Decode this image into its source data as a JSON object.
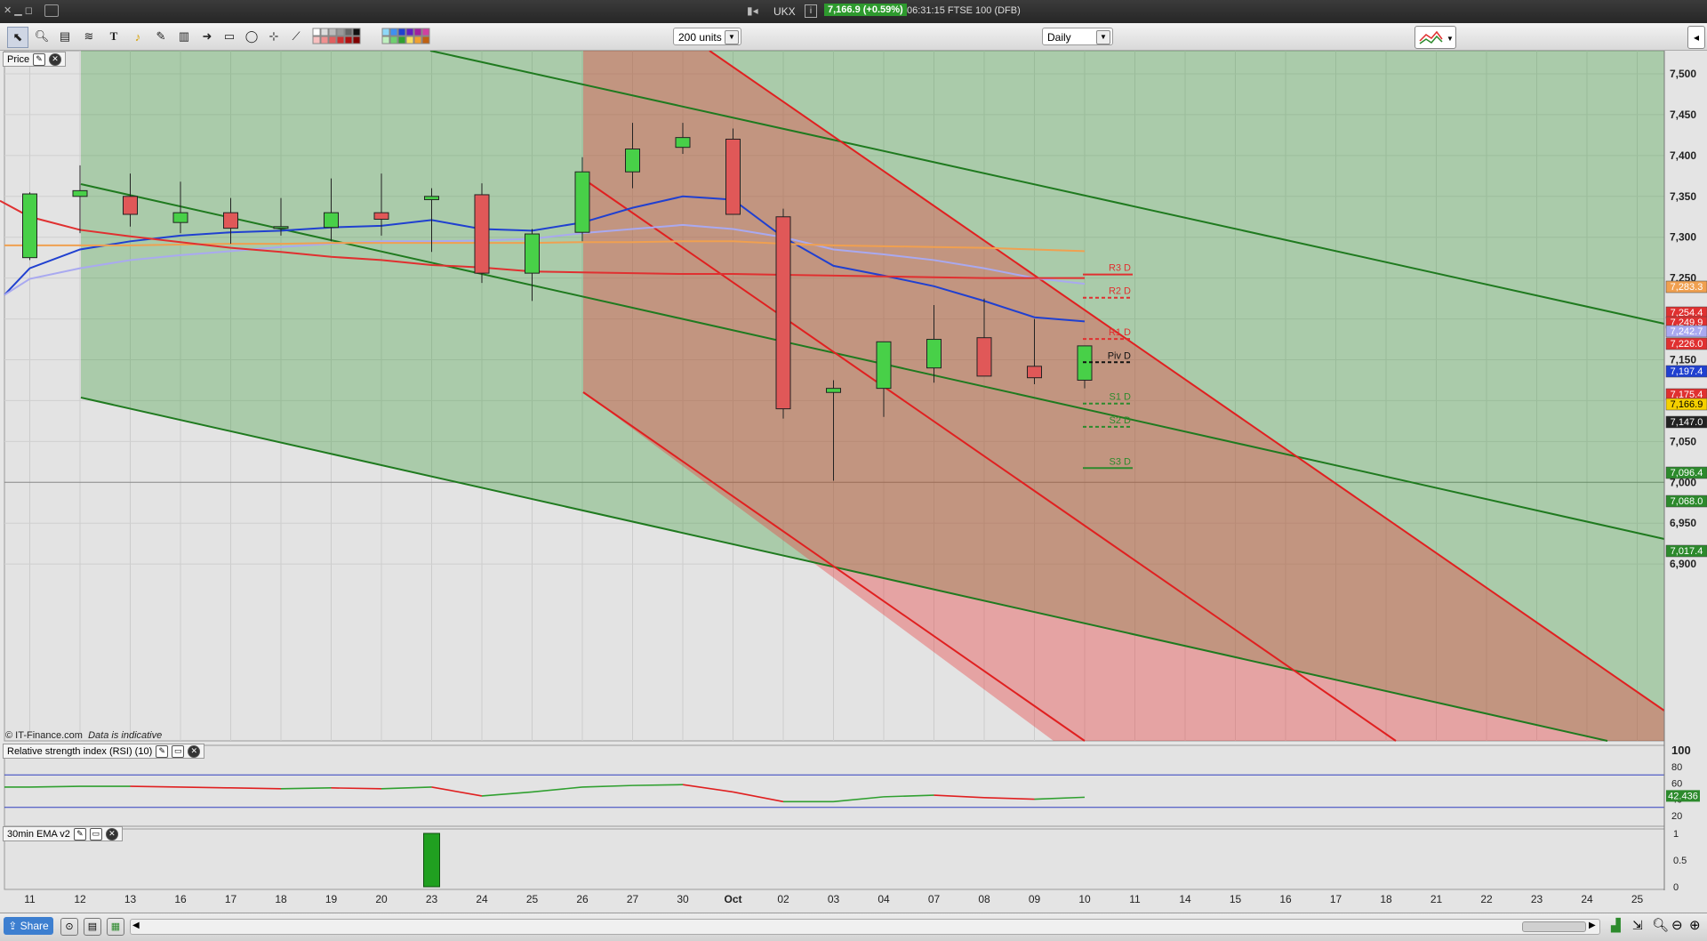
{
  "window": {
    "symbol": "UKX",
    "price_badge": "7,166.9 (+0.59%)",
    "status": "06:31:15 FTSE 100 (DFB)",
    "info_icon": "i"
  },
  "toolbar": {
    "units_select": "200 units",
    "period_select": "Daily",
    "text_tool": "T"
  },
  "panels": {
    "price_label": "Price",
    "rsi_label": "Relative strength index (RSI) (10)",
    "ema_label": "30min EMA v2",
    "copyright": "© IT-Finance.com",
    "disclaimer": "Data is indicative"
  },
  "price_axis": {
    "ticks": [
      "7,500",
      "7,450",
      "7,400",
      "7,350",
      "7,300",
      "7,250",
      "7,200",
      "7,150",
      "7,100",
      "7,050",
      "7,000",
      "6,950",
      "6,900"
    ],
    "badges": [
      {
        "text": "7,283.3",
        "color": "#f0a050",
        "fg": "#ffffff"
      },
      {
        "text": "7,254.4",
        "color": "#e03030",
        "fg": "#ffffff"
      },
      {
        "text": "7,249.9",
        "color": "#e03030",
        "fg": "#ffffff"
      },
      {
        "text": "7,242.7",
        "color": "#a9a9f0",
        "fg": "#ffffff"
      },
      {
        "text": "7,226.0",
        "color": "#e03030",
        "fg": "#ffffff"
      },
      {
        "text": "7,197.4",
        "color": "#2040d0",
        "fg": "#ffffff"
      },
      {
        "text": "7,175.4",
        "color": "#e03030",
        "fg": "#ffffff"
      },
      {
        "text": "7,166.9",
        "color": "#f5d000",
        "fg": "#000000"
      },
      {
        "text": "7,147.0",
        "color": "#222222",
        "fg": "#ffffff"
      },
      {
        "text": "7,096.4",
        "color": "#2c8a2c",
        "fg": "#ffffff"
      },
      {
        "text": "7,068.0",
        "color": "#2c8a2c",
        "fg": "#ffffff"
      },
      {
        "text": "7,017.4",
        "color": "#2c8a2c",
        "fg": "#ffffff"
      }
    ]
  },
  "pivots": [
    {
      "label": "R3 D",
      "value": 7254.4,
      "color": "#e03030",
      "style": "solid"
    },
    {
      "label": "R2 D",
      "value": 7226.0,
      "color": "#e03030",
      "style": "dashed"
    },
    {
      "label": "R1 D",
      "value": 7175.4,
      "color": "#e03030",
      "style": "dashed"
    },
    {
      "label": "Piv D",
      "value": 7147.0,
      "color": "#111111",
      "style": "dashed"
    },
    {
      "label": "S1 D",
      "value": 7096.4,
      "color": "#2c8a2c",
      "style": "dashed"
    },
    {
      "label": "S2 D",
      "value": 7068.0,
      "color": "#2c8a2c",
      "style": "dashed"
    },
    {
      "label": "S3 D",
      "value": 7017.4,
      "color": "#2c8a2c",
      "style": "solid"
    }
  ],
  "x_axis": {
    "labels": [
      "11",
      "12",
      "13",
      "16",
      "17",
      "18",
      "19",
      "20",
      "23",
      "24",
      "25",
      "26",
      "27",
      "30",
      "Oct",
      "02",
      "03",
      "04",
      "07",
      "08",
      "09",
      "10",
      "11",
      "14",
      "15",
      "16",
      "17",
      "18",
      "21",
      "22",
      "23",
      "24",
      "25"
    ]
  },
  "rsi_axis": {
    "ticks": [
      "100",
      "80",
      "60",
      "40",
      "20"
    ],
    "value_badge": "42.436",
    "upper_level": 70,
    "lower_level": 30
  },
  "ema_axis": {
    "ticks": [
      "1",
      "0.5",
      "0"
    ]
  },
  "chart_data": {
    "type": "candlestick",
    "categories": [
      "11",
      "12",
      "13",
      "16",
      "17",
      "18",
      "19",
      "20",
      "23",
      "24",
      "25",
      "26",
      "27",
      "30",
      "Oct",
      "02",
      "03",
      "04",
      "07",
      "08",
      "09",
      "10"
    ],
    "ohlc": [
      [
        7275,
        7355,
        7272,
        7353
      ],
      [
        7350,
        7388,
        7305,
        7357
      ],
      [
        7350,
        7378,
        7313,
        7328
      ],
      [
        7318,
        7368,
        7305,
        7330
      ],
      [
        7330,
        7348,
        7292,
        7311
      ],
      [
        7312,
        7348,
        7302,
        7313
      ],
      [
        7312,
        7372,
        7295,
        7330
      ],
      [
        7330,
        7378,
        7302,
        7322
      ],
      [
        7346,
        7360,
        7282,
        7350
      ],
      [
        7352,
        7366,
        7244,
        7256
      ],
      [
        7256,
        7310,
        7222,
        7304
      ],
      [
        7306,
        7398,
        7295,
        7380
      ],
      [
        7380,
        7440,
        7360,
        7408
      ],
      [
        7410,
        7440,
        7402,
        7422
      ],
      [
        7420,
        7433,
        7328,
        7328
      ],
      [
        7325,
        7335,
        7078,
        7090
      ],
      [
        7110,
        7125,
        7002,
        7115
      ],
      [
        7115,
        7172,
        7080,
        7172
      ],
      [
        7140,
        7217,
        7122,
        7175
      ],
      [
        7177,
        7225,
        7132,
        7130
      ],
      [
        7142,
        7200,
        7120,
        7128
      ],
      [
        7125,
        7165,
        7115,
        7167
      ]
    ],
    "moving_averages": [
      {
        "color": "#2040d0",
        "values": [
          7262,
          7285,
          7295,
          7302,
          7306,
          7308,
          7312,
          7314,
          7321,
          7310,
          7308,
          7318,
          7336,
          7350,
          7346,
          7300,
          7265,
          7253,
          7240,
          7222,
          7202,
          7197
        ]
      },
      {
        "color": "#a9a9f0",
        "values": [
          7249,
          7262,
          7272,
          7278,
          7283,
          7288,
          7292,
          7295,
          7295,
          7296,
          7298,
          7305,
          7310,
          7315,
          7310,
          7300,
          7285,
          7279,
          7272,
          7262,
          7250,
          7243
        ]
      },
      {
        "color": "#f0a050",
        "values": [
          7290,
          7290,
          7290,
          7291,
          7292,
          7292,
          7293,
          7293,
          7293,
          7293,
          7293,
          7294,
          7294,
          7295,
          7295,
          7292,
          7290,
          7289,
          7288,
          7287,
          7285,
          7283
        ]
      },
      {
        "color": "#e03030",
        "values": [
          7325,
          7309,
          7301,
          7294,
          7287,
          7282,
          7276,
          7272,
          7266,
          7263,
          7258,
          7257,
          7256,
          7255,
          7255,
          7254,
          7253,
          7252,
          7251,
          7250,
          7250,
          7250
        ]
      }
    ],
    "rsi": [
      55,
      56,
      56,
      55,
      54,
      53,
      54,
      53,
      55,
      44,
      49,
      55,
      57,
      58,
      49,
      37,
      37,
      43,
      45,
      42,
      40,
      42.436
    ],
    "ema_signal": [
      0,
      0,
      0,
      0,
      0,
      0,
      0,
      0,
      1,
      0,
      0,
      0,
      0,
      0,
      0,
      0,
      0,
      0,
      0,
      0,
      0,
      0
    ],
    "ylim": [
      6865,
      7520
    ]
  }
}
